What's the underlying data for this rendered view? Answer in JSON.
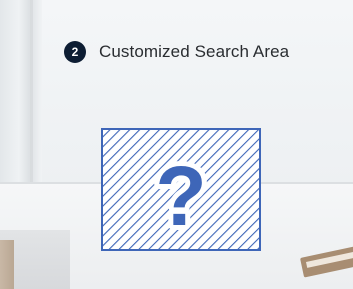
{
  "callout": {
    "step_number": "2",
    "title": "Customized Search Area"
  },
  "placeholder": {
    "icon": "question-mark-icon",
    "glyph": "?",
    "color": "#3e66b8"
  },
  "colors": {
    "badge": "#0d1d33",
    "text": "#2a2d31",
    "accent": "#3e66b8"
  }
}
